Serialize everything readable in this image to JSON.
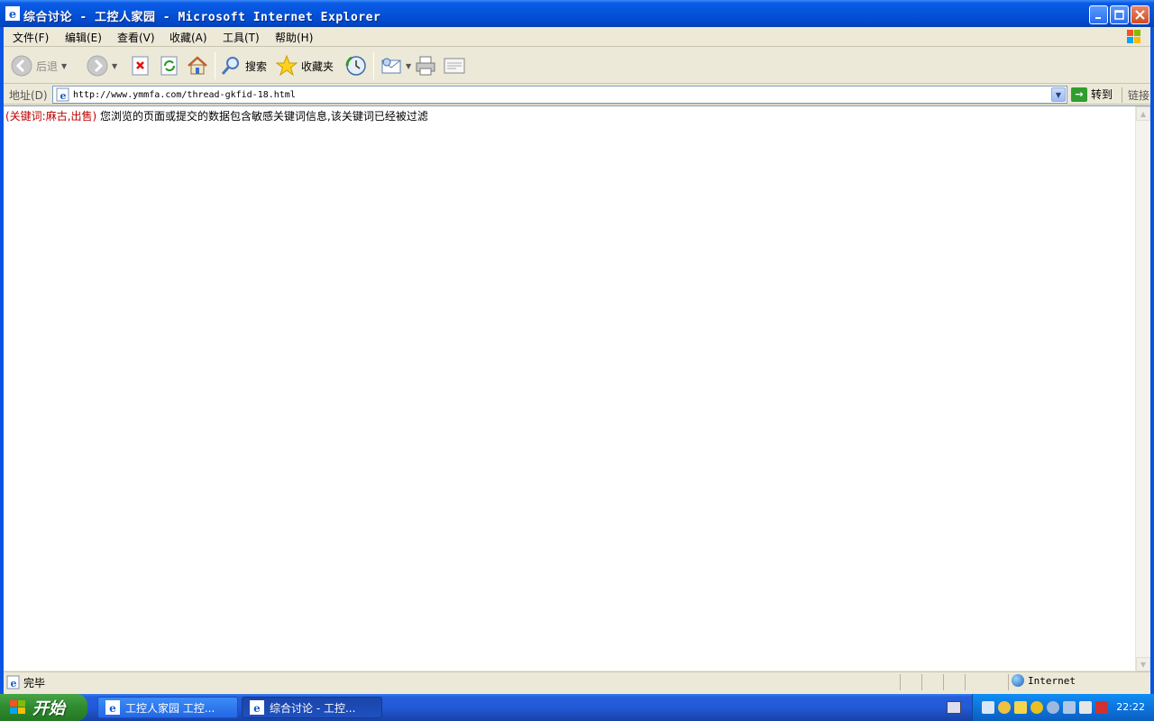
{
  "window": {
    "title": "综合讨论 - 工控人家园 - Microsoft Internet Explorer"
  },
  "menu": {
    "items": [
      "文件(F)",
      "编辑(E)",
      "查看(V)",
      "收藏(A)",
      "工具(T)",
      "帮助(H)"
    ]
  },
  "toolbar": {
    "back_label": "后退",
    "search_label": "搜索",
    "favorites_label": "收藏夹"
  },
  "address": {
    "label": "地址(D)",
    "url": "http://www.ymmfa.com/thread-gkfid-18.html",
    "go_label": "转到",
    "links_label": "链接"
  },
  "content": {
    "keywords": "(关键词:麻古,出售)",
    "message": " 您浏览的页面或提交的数据包含敏感关键词信息,该关键词已经被过滤"
  },
  "status": {
    "text": "完毕",
    "zone": "Internet"
  },
  "taskbar": {
    "start_label": "开始",
    "tasks": [
      {
        "label": "工控人家园 工控..."
      },
      {
        "label": "综合讨论 - 工控..."
      }
    ],
    "clock": "22:22"
  },
  "colors": {
    "keyword_red": "#c00000",
    "titlebar_blue": "#0553d8",
    "taskbar_blue": "#225ad7",
    "start_green": "#2f8a2f"
  }
}
